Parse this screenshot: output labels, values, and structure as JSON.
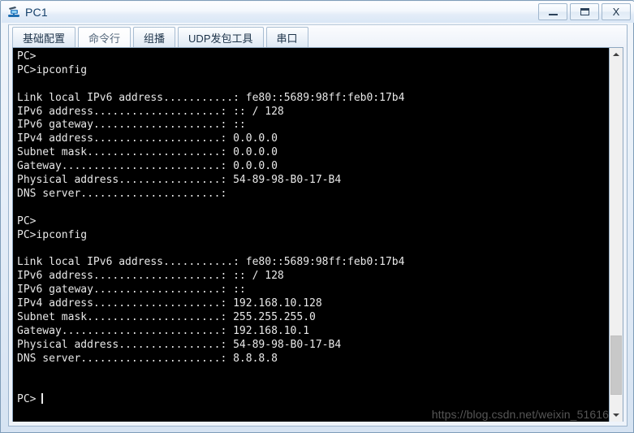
{
  "window": {
    "title": "PC1",
    "icon": "pc-device-icon",
    "controls": {
      "minimize": "—",
      "maximize": "▭",
      "close": "X"
    }
  },
  "tabs": [
    {
      "label": "基础配置",
      "name": "tab-basic-config",
      "selected": false
    },
    {
      "label": "命令行",
      "name": "tab-command-line",
      "selected": true
    },
    {
      "label": "组播",
      "name": "tab-multicast",
      "selected": false
    },
    {
      "label": "UDP发包工具",
      "name": "tab-udp-packet-tool",
      "selected": false
    },
    {
      "label": "串口",
      "name": "tab-serial-port",
      "selected": false
    }
  ],
  "terminal": {
    "background": "#000000",
    "foreground": "#e8e8e8",
    "lines": [
      "PC>",
      "PC>ipconfig",
      "",
      "Link local IPv6 address...........: fe80::5689:98ff:feb0:17b4",
      "IPv6 address....................: :: / 128",
      "IPv6 gateway....................: ::",
      "IPv4 address....................: 0.0.0.0",
      "Subnet mask.....................: 0.0.0.0",
      "Gateway.........................: 0.0.0.0",
      "Physical address................: 54-89-98-B0-17-B4",
      "DNS server......................:",
      "",
      "PC>",
      "PC>ipconfig",
      "",
      "Link local IPv6 address...........: fe80::5689:98ff:feb0:17b4",
      "IPv6 address....................: :: / 128",
      "IPv6 gateway....................: ::",
      "IPv4 address....................: 192.168.10.128",
      "Subnet mask.....................: 255.255.255.0",
      "Gateway.........................: 192.168.10.1",
      "Physical address................: 54-89-98-B0-17-B4",
      "DNS server......................: 8.8.8.8",
      "",
      ""
    ],
    "prompt": "PC>",
    "watermark": "https://blog.csdn.net/weixin_51616"
  },
  "scrollbar": {
    "up_arrow": "scroll-up-arrow-icon",
    "down_arrow": "scroll-down-arrow-icon",
    "thumb_top_pct": 79,
    "thumb_height_pct": 17
  }
}
